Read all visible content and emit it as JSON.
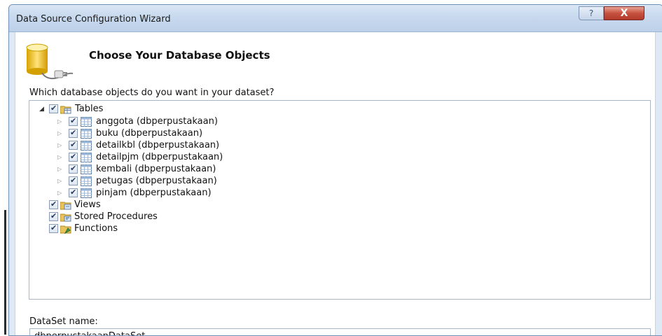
{
  "window": {
    "title": "Data Source Configuration Wizard",
    "help_label": "?",
    "close_label": "X"
  },
  "header": {
    "title": "Choose Your Database Objects",
    "icon": "database-connection-icon"
  },
  "prompt": "Which database objects do you want in your dataset?",
  "tree": {
    "tables_label": "Tables",
    "tables": [
      {
        "label": "anggota (dbperpustakaan)",
        "checked": true
      },
      {
        "label": "buku (dbperpustakaan)",
        "checked": true
      },
      {
        "label": "detailkbl (dbperpustakaan)",
        "checked": true
      },
      {
        "label": "detailpjm (dbperpustakaan)",
        "checked": true
      },
      {
        "label": "kembali (dbperpustakaan)",
        "checked": true
      },
      {
        "label": "petugas (dbperpustakaan)",
        "checked": true
      },
      {
        "label": "pinjam (dbperpustakaan)",
        "checked": true
      }
    ],
    "views_label": "Views",
    "stored_procedures_label": "Stored Procedures",
    "functions_label": "Functions"
  },
  "dataset": {
    "label": "DataSet name:",
    "value": "dbperpustakaanDataSet"
  },
  "colors": {
    "titlebar": "#c8d9ee",
    "close_button": "#c7513f",
    "accent": "#2a3f66"
  }
}
